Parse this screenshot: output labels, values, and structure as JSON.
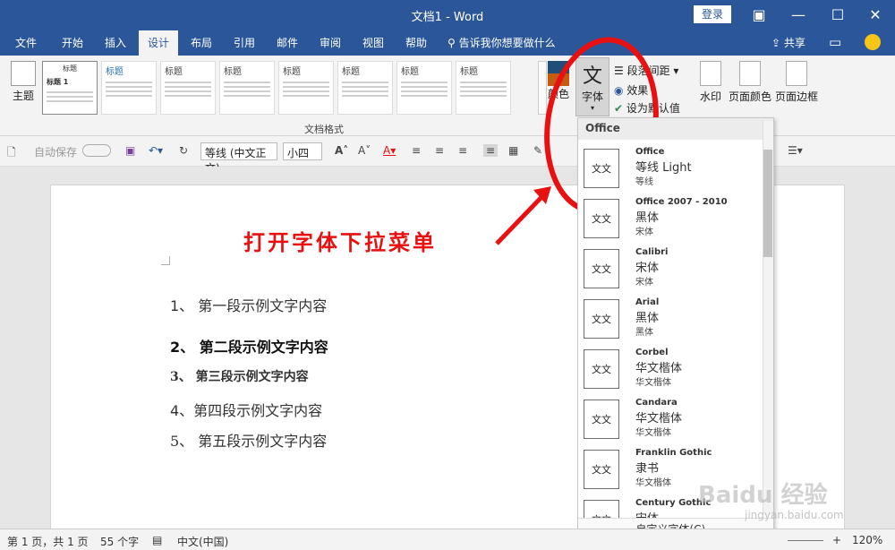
{
  "window": {
    "title": "文档1  -  Word",
    "login_label": "登录"
  },
  "menu": {
    "tabs": [
      "文件",
      "开始",
      "插入",
      "设计",
      "布局",
      "引用",
      "邮件",
      "审阅",
      "视图",
      "帮助"
    ],
    "active": "设计",
    "tellme": "告诉我你想要做什么",
    "share": "共享"
  },
  "ribbon": {
    "theme_label": "主题",
    "style_title": "标题",
    "style_h1": "标题 1",
    "group_label": "文档格式",
    "colors_label": "颜色",
    "fonts_label": "字体",
    "fonts_glyph": "文",
    "para_spacing": "段落间距",
    "effects": "效果",
    "set_default": "设为默认值",
    "watermark": "水印",
    "page_color": "页面颜色",
    "page_border": "页面边框"
  },
  "qat": {
    "autosave": "自动保存",
    "font_name": "等线 (中文正文)",
    "font_size": "小四"
  },
  "document": {
    "paragraphs": [
      "1、  第一段示例文字内容",
      "2、  第二段示例文字内容",
      "3、  第三段示例文字内容",
      "4、第四段示例文字内容",
      "5、  第五段示例文字内容"
    ],
    "annotation": "打开字体下拉菜单"
  },
  "font_dropdown": {
    "header": "Office",
    "items": [
      {
        "name": "Office",
        "heading_font": "等线 Light",
        "body_font": "等线"
      },
      {
        "name": "Office 2007 - 2010",
        "heading_font": "黑体",
        "body_font": "宋体"
      },
      {
        "name": "Calibri",
        "heading_font": "宋体",
        "body_font": "宋体"
      },
      {
        "name": "Arial",
        "heading_font": "黑体",
        "body_font": "黑体"
      },
      {
        "name": "Corbel",
        "heading_font": "华文楷体",
        "body_font": "华文楷体"
      },
      {
        "name": "Candara",
        "heading_font": "华文楷体",
        "body_font": "华文楷体"
      },
      {
        "name": "Franklin Gothic",
        "heading_font": "隶书",
        "body_font": "华文楷体"
      },
      {
        "name": "Century Gothic",
        "heading_font": "宋体",
        "body_font": ""
      }
    ],
    "thumb_text": "文文",
    "footer": "自定义字体(C)..."
  },
  "status": {
    "page": "第 1 页，共 1 页",
    "words": "55 个字",
    "lang": "中文(中国)",
    "zoom": "120%"
  },
  "watermark": {
    "brand": "Baidu 经验",
    "url": "jingyan.baidu.com"
  },
  "colors": {
    "brand": "#2b579a",
    "annotation": "#e81010"
  }
}
